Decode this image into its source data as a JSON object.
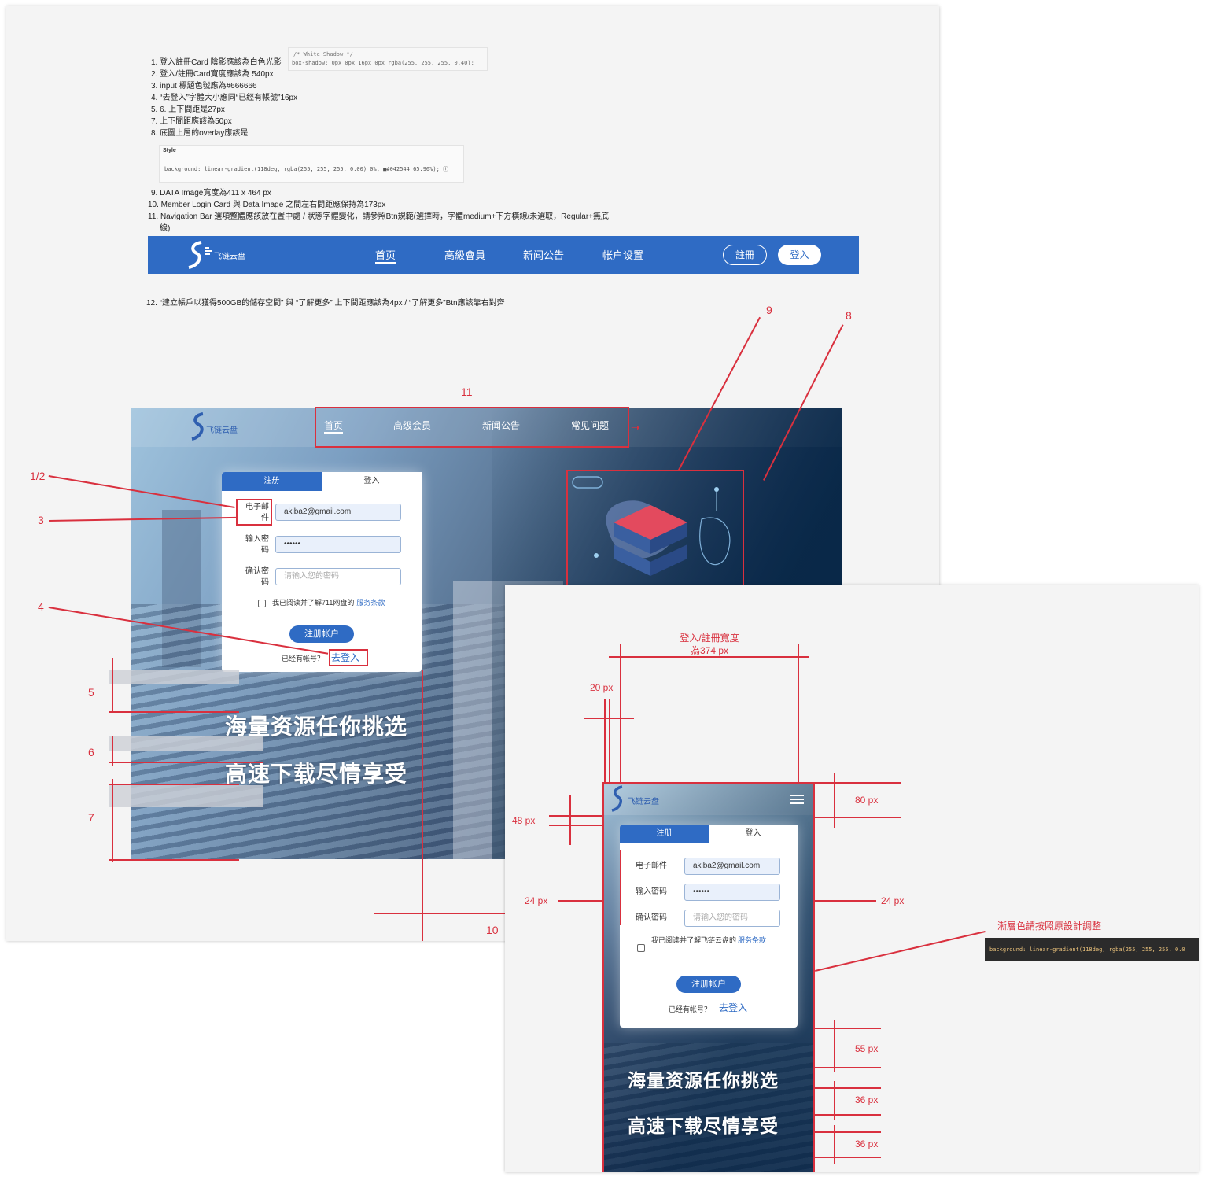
{
  "notes": {
    "n1": "1. 登入註冊Card 陰影應該為白色光影",
    "n2": "2. 登入/註冊Card寬度應該為 540px",
    "n3": "3. input 標題色號應為#666666",
    "n4": "4. “去登入”字體大小應同“已經有帳號”16px",
    "n5": "5. 6. 上下間距是27px",
    "n7": "7. 上下間距應該為50px",
    "n8": "8. 底圖上層的overlay應該是",
    "n9": "9. DATA Image寬度為411 x 464 px",
    "n10": "10. Member Login Card 與 Data Image 之間左右間距應保持為173px",
    "n11a": "11. Navigation Bar 選項整體應該放在置中處 / 狀態字體變化，請參照Btn規範(選擇時，字體medium+下方橫線/未選取，Regular+無底",
    "n11b": "線)",
    "n12": "12. “建立帳戶以獲得500GB的儲存空間” 與 “了解更多” 上下間距應該為4px / “了解更多”Btn應該靠右對齊"
  },
  "snippets": {
    "shadow_comment": "/* White Shadow */",
    "shadow_prop": "box-shadow: 0px 0px 16px 0px  rgba(255, 255, 255, 0.40);",
    "style_title": "Style",
    "gradient_prop": "background: linear-gradient(118deg,  rgba(255, 255, 255, 0.00) 0%, ■#042544 65.90%); ⓘ",
    "mobile_gradient": "background: linear-gradient(118deg,   rgba(255, 255, 255, 0.0"
  },
  "navbar": {
    "brand": "飞链云盘",
    "items": [
      "首页",
      "高級會員",
      "新闻公告",
      "帐户设置"
    ],
    "register": "註冊",
    "login": "登入"
  },
  "desktop": {
    "brand": "飞链云盘",
    "nav": [
      "首页",
      "高级会员",
      "新闻公告",
      "常见问题"
    ],
    "tab_register": "注册",
    "tab_login": "登入",
    "label_email": "电子邮件",
    "label_password": "输入密码",
    "label_confirm": "确认密码",
    "email_value": "akiba2@gmail.com",
    "password_value": "••••••",
    "confirm_placeholder": "请输入您的密码",
    "agree_text": "我已阅读并了解711网盘的",
    "terms_link": "服务条款",
    "submit": "注册帐户",
    "have_account": "已经有帐号？",
    "goto_login": "去登入",
    "hero1": "海量资源任你挑选",
    "hero2": "高速下载尽情享受"
  },
  "mobile": {
    "brand": "飞链云盘",
    "tab_register": "注册",
    "tab_login": "登入",
    "label_email": "电子邮件",
    "label_password": "输入密码",
    "label_confirm": "确认密码",
    "email_value": "akiba2@gmail.com",
    "password_value": "••••••",
    "confirm_placeholder": "请输入您的密码",
    "agree_text": "我已阅读并了解飞链云盘的",
    "terms_link": "服务条款",
    "submit": "注册帐户",
    "have_account": "已经有帐号？",
    "goto_login": "去登入",
    "hero1": "海量资源任你挑选",
    "hero2": "高速下载尽情享受"
  },
  "annotations": {
    "a1_2": "1/2",
    "a3": "3",
    "a4": "4",
    "a5": "5",
    "a6": "6",
    "a7": "7",
    "a8": "8",
    "a9": "9",
    "a10": "10",
    "a11": "11",
    "width_title_1": "登入/註冊寬度",
    "width_title_2": "為374 px",
    "px20": "20 px",
    "px48": "48 px",
    "px24_left": "24 px",
    "px24_right": "24 px",
    "px80": "80 px",
    "px55": "55 px",
    "px36a": "36 px",
    "px36b": "36 px",
    "gradient_note": "漸層色請按照原設計調整"
  },
  "colors": {
    "brand_blue": "#2f6bc4",
    "annotation_red": "#d9303e",
    "overlay_dark": "#042544"
  }
}
